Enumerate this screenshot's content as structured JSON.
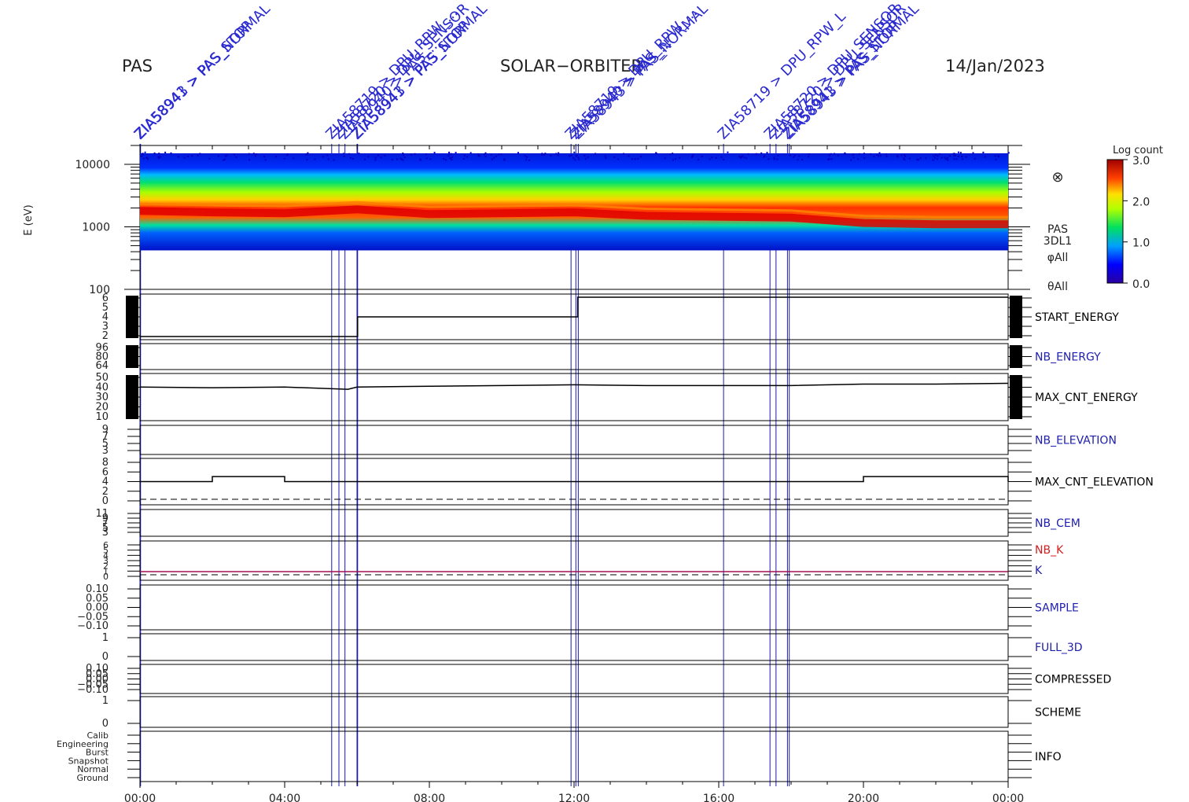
{
  "header": {
    "instrument": "PAS",
    "mission": "SOLAR−ORBITER",
    "date": "14/Jan/2023"
  },
  "events": [
    {
      "time": "00:00",
      "label": "ZIA58941 > PAS_STOP"
    },
    {
      "time": "00:01",
      "label": "ZIA58943 > PAS_NORMAL"
    },
    {
      "time": "05:18",
      "label": "ZIA58719 > DPU_RPW_..."
    },
    {
      "time": "05:30",
      "label": "ZIA58720 > DPU_SENSOR"
    },
    {
      "time": "05:40",
      "label": "ZIA58940 > PAS_..."
    },
    {
      "time": "06:00",
      "label": "ZIA58941 > PAS_STOP"
    },
    {
      "time": "06:01",
      "label": "ZIA58943 > PAS_NORMAL"
    },
    {
      "time": "11:55",
      "label": "ZIA58719 > DPU_RPW_..."
    },
    {
      "time": "12:03",
      "label": "ZIA58940 > PAS_..."
    },
    {
      "time": "12:07",
      "label": "ZIA58943 > PAS_NORMAL"
    },
    {
      "time": "16:08",
      "label": "ZIA58719 > DPU_RPW_L"
    },
    {
      "time": "17:25",
      "label": "ZIA58720 > DPU_SENSOR"
    },
    {
      "time": "17:35",
      "label": "ZIA58720 > DPU_SENSOR"
    },
    {
      "time": "17:54",
      "label": "ZIA58941 > PAS_STOP"
    },
    {
      "time": "17:57",
      "label": "ZIA58943 > PAS_NORMAL"
    }
  ],
  "xaxis": {
    "ticks": [
      "00:00",
      "04:00",
      "08:00",
      "12:00",
      "16:00",
      "20:00",
      "00:00"
    ]
  },
  "spectrogram": {
    "ylabel": "E (eV)",
    "yticks": [
      "10000",
      "1000",
      "100"
    ],
    "side_labels": [
      "PAS",
      "3DL1",
      "φAll",
      "θAll"
    ],
    "symbol": "⊗",
    "colorbar": {
      "title": "Log count",
      "ticks": [
        "3.0",
        "2.0",
        "1.0",
        "0.0"
      ]
    }
  },
  "panels": [
    {
      "id": "start_energy",
      "label": "START_ENERGY",
      "label_color": "#000000",
      "yticks": [
        "6",
        "5",
        "4",
        "3",
        "2"
      ]
    },
    {
      "id": "nb_energy",
      "label": "NB_ENERGY",
      "label_color": "#2020b0",
      "yticks": [
        "96",
        "80",
        "64"
      ]
    },
    {
      "id": "max_cnt_energy",
      "label": "MAX_CNT_ENERGY",
      "label_color": "#000000",
      "yticks": [
        "50",
        "40",
        "30",
        "20",
        "10"
      ]
    },
    {
      "id": "nb_elevation",
      "label": "NB_ELEVATION",
      "label_color": "#2020b0",
      "yticks": [
        "9",
        "7",
        "5",
        "3"
      ]
    },
    {
      "id": "max_cnt_elevation",
      "label": "MAX_CNT_ELEVATION",
      "label_color": "#000000",
      "yticks": [
        "8",
        "6",
        "4",
        "2",
        "0"
      ]
    },
    {
      "id": "nb_cem",
      "label": "NB_CEM",
      "label_color": "#2020b0",
      "yticks": [
        "11",
        "9",
        "7",
        "5",
        "3"
      ]
    },
    {
      "id": "nb_k",
      "label": "NB_K",
      "label2": "K",
      "label_color": "#d02020",
      "label2_color": "#2020b0",
      "yticks": [
        "6",
        "5",
        "4",
        "3",
        "2",
        "1",
        "0"
      ]
    },
    {
      "id": "sample",
      "label": "SAMPLE",
      "label_color": "#2020b0",
      "yticks": [
        "0.10",
        "0.05",
        "0.00",
        "−0.05",
        "−0.10"
      ]
    },
    {
      "id": "full_3d",
      "label": "FULL_3D",
      "label_color": "#2020b0",
      "yticks": [
        "1",
        "0"
      ]
    },
    {
      "id": "compressed",
      "label": "COMPRESSED",
      "label_color": "#000000",
      "yticks": [
        "0.10",
        "0.05",
        "0.00",
        "−0.05",
        "−0.10"
      ]
    },
    {
      "id": "scheme",
      "label": "SCHEME",
      "label_color": "#000000",
      "yticks": [
        "1",
        "0"
      ]
    },
    {
      "id": "info",
      "label": "INFO",
      "label_color": "#000000",
      "yticks": [
        "Calib",
        "Engineering",
        "Burst",
        "Snapshot",
        "Normal",
        "Ground"
      ]
    }
  ],
  "chart_data": [
    {
      "type": "heatmap",
      "title": "",
      "ylabel": "E (eV)",
      "yscale": "log",
      "ylim": [
        100,
        20000
      ],
      "x": [
        "00:00",
        "02:00",
        "04:00",
        "06:00",
        "08:00",
        "10:00",
        "12:00",
        "14:00",
        "16:00",
        "18:00",
        "20:00",
        "22:00",
        "24:00"
      ],
      "peak_energy_eV": [
        1800,
        1700,
        1650,
        1900,
        1600,
        1650,
        1700,
        1500,
        1450,
        1400,
        1150,
        1100,
        1100
      ],
      "zlabel": "Log count",
      "zlim": [
        0.0,
        3.0
      ]
    },
    {
      "type": "line",
      "name": "START_ENERGY",
      "x": [
        "00:00",
        "06:00",
        "06:01",
        "12:05",
        "12:06",
        "24:00"
      ],
      "values": [
        2,
        2,
        4,
        4,
        6,
        6
      ],
      "ylim": [
        2,
        6
      ]
    },
    {
      "type": "line",
      "name": "MAX_CNT_ENERGY",
      "x": [
        "00:00",
        "02:00",
        "04:00",
        "05:45",
        "06:00",
        "08:00",
        "10:00",
        "12:00",
        "14:00",
        "16:00",
        "18:00",
        "20:00",
        "22:00",
        "24:00"
      ],
      "values": [
        41,
        40,
        41,
        38,
        41,
        42,
        43,
        44,
        43,
        43,
        43,
        45,
        45,
        46
      ],
      "ylim": [
        0,
        55
      ]
    },
    {
      "type": "line",
      "name": "MAX_CNT_ELEVATION",
      "x": [
        "00:00",
        "02:00",
        "04:00",
        "06:00",
        "08:00",
        "10:00",
        "12:00",
        "14:00",
        "16:00",
        "18:00",
        "20:00",
        "22:00",
        "24:00"
      ],
      "values": [
        4,
        5,
        4,
        4,
        4,
        4,
        4,
        4,
        4,
        4,
        5,
        5,
        4
      ],
      "ylim": [
        0,
        8
      ]
    },
    {
      "type": "line",
      "name": "K",
      "x": [
        "00:00",
        "24:00"
      ],
      "values": [
        1,
        1
      ],
      "ylim": [
        0,
        6
      ]
    }
  ]
}
